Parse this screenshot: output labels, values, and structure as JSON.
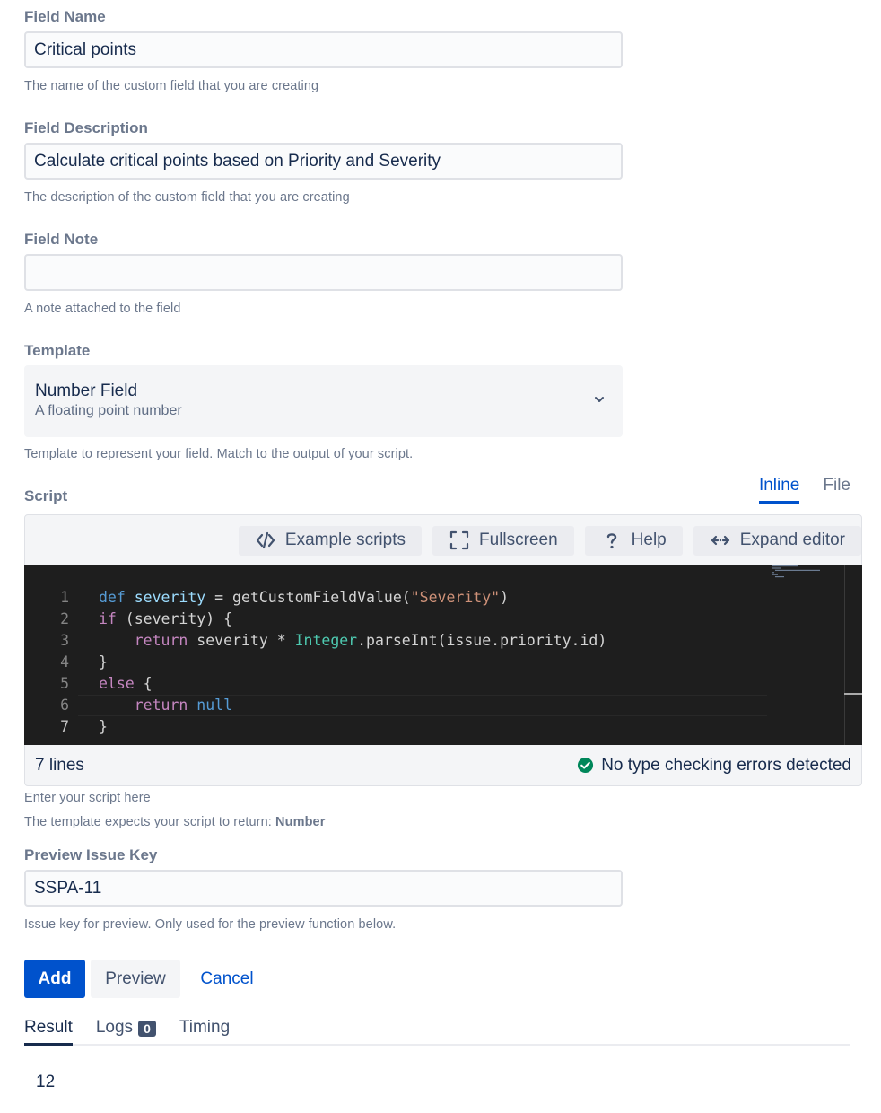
{
  "field_name": {
    "label": "Field Name",
    "value": "Critical points",
    "helper": "The name of the custom field that you are creating"
  },
  "field_description": {
    "label": "Field Description",
    "value": "Calculate critical points based on Priority and Severity",
    "helper": "The description of the custom field that you are creating"
  },
  "field_note": {
    "label": "Field Note",
    "value": "",
    "helper": "A note attached to the field"
  },
  "template": {
    "label": "Template",
    "selected_title": "Number Field",
    "selected_subtitle": "A floating point number",
    "helper": "Template to represent your field. Match to the output of your script."
  },
  "script": {
    "label": "Script",
    "tabs": [
      "Inline",
      "File"
    ],
    "active_tab": "Inline",
    "toolbar": {
      "example_scripts": "Example scripts",
      "fullscreen": "Fullscreen",
      "help": "Help",
      "expand_editor": "Expand editor"
    },
    "code_lines": [
      "def severity = getCustomFieldValue(\"Severity\")",
      "if (severity) {",
      "    return severity * Integer.parseInt(issue.priority.id)",
      "}",
      "else {",
      "    return null",
      "}"
    ],
    "line_count_text": "7 lines",
    "status_text": "No type checking errors detected",
    "helper": "Enter your script here",
    "return_hint_prefix": "The template expects your script to return:",
    "return_type": "Number"
  },
  "preview_issue_key": {
    "label": "Preview Issue Key",
    "value": "SSPA-11",
    "helper": "Issue key for preview. Only used for the preview function below."
  },
  "actions": {
    "add": "Add",
    "preview": "Preview",
    "cancel": "Cancel"
  },
  "result_tabs": {
    "result": "Result",
    "logs": "Logs",
    "logs_count": "0",
    "timing": "Timing"
  },
  "result_value": "12",
  "colors": {
    "primary": "#0052cc",
    "success": "#00875a",
    "editor_bg": "#1e1e1e"
  },
  "icons": [
    "code-icon",
    "fullscreen-icon",
    "help-icon",
    "expand-icon",
    "chevron-down-icon",
    "check-circle-icon"
  ]
}
